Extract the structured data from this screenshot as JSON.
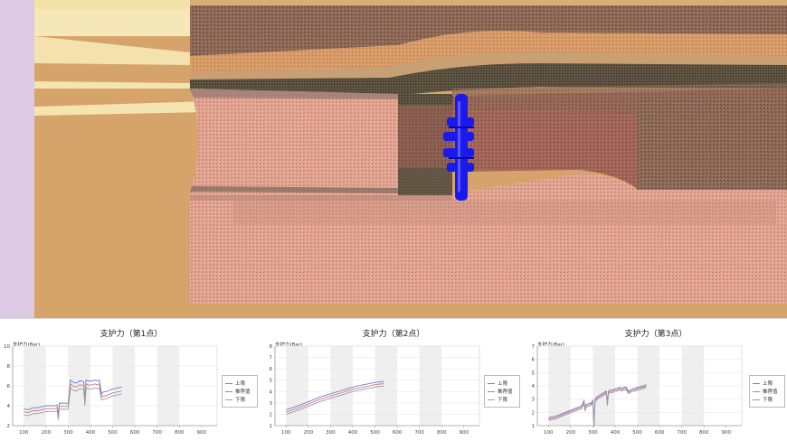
{
  "colors": {
    "cutter_head": "#1a1aee",
    "series_upper": "#6a7fd0",
    "series_recommended": "#d07a7a",
    "series_lower": "#9a9aa8"
  },
  "scene": {
    "name": "tbm-tunnel-3d-view",
    "icon": "cutter-head-icon"
  },
  "charts": [
    {
      "title": "支护力（第1点）",
      "unit_label": "支护力(Bar)",
      "legend": [
        "上限",
        "推荐值",
        "下限"
      ],
      "chart_data": {
        "type": "line",
        "xlim": [
          50,
          970
        ],
        "ylim": [
          2,
          10
        ],
        "x_ticks": [
          100,
          200,
          300,
          400,
          500,
          600,
          700,
          800,
          900
        ],
        "y_ticks": [
          2,
          4,
          6,
          8,
          10
        ],
        "shaded_bands": [
          [
            100,
            200
          ],
          [
            300,
            400
          ],
          [
            500,
            600
          ],
          [
            700,
            800
          ]
        ],
        "series": [
          {
            "name": "上限",
            "x": [
              100,
              120,
              140,
              160,
              180,
              200,
              220,
              240,
              250,
              255,
              260,
              270,
              280,
              290,
              300,
              310,
              320,
              330,
              340,
              350,
              360,
              370,
              375,
              380,
              390,
              400,
              410,
              420,
              430,
              440,
              450,
              460,
              470,
              480,
              490,
              500,
              510,
              520,
              530,
              540
            ],
            "y": [
              3.7,
              3.6,
              3.8,
              3.8,
              3.9,
              4.0,
              4.0,
              4.0,
              4.1,
              3.0,
              4.3,
              4.2,
              4.3,
              4.2,
              4.3,
              6.6,
              6.4,
              6.3,
              6.3,
              6.5,
              6.5,
              6.4,
              4.6,
              6.6,
              6.5,
              6.5,
              6.5,
              6.6,
              6.5,
              6.6,
              5.2,
              5.4,
              5.4,
              5.5,
              5.6,
              5.7,
              5.7,
              5.8,
              5.8,
              5.9
            ]
          },
          {
            "name": "推荐值",
            "x": [
              100,
              120,
              140,
              160,
              180,
              200,
              220,
              240,
              250,
              255,
              260,
              270,
              280,
              290,
              300,
              310,
              320,
              330,
              340,
              350,
              360,
              370,
              375,
              380,
              390,
              400,
              410,
              420,
              430,
              440,
              450,
              460,
              470,
              480,
              490,
              500,
              510,
              520,
              530,
              540
            ],
            "y": [
              3.4,
              3.3,
              3.5,
              3.5,
              3.6,
              3.7,
              3.7,
              3.7,
              3.8,
              2.8,
              4.0,
              3.9,
              4.0,
              3.9,
              4.0,
              6.2,
              6.0,
              5.9,
              5.9,
              6.1,
              6.1,
              6.0,
              4.3,
              6.2,
              6.1,
              6.1,
              6.1,
              6.2,
              6.1,
              6.2,
              4.9,
              5.0,
              5.0,
              5.1,
              5.2,
              5.3,
              5.3,
              5.4,
              5.4,
              5.5
            ]
          },
          {
            "name": "下限",
            "x": [
              100,
              120,
              140,
              160,
              180,
              200,
              220,
              240,
              250,
              255,
              260,
              270,
              280,
              290,
              300,
              310,
              320,
              330,
              340,
              350,
              360,
              370,
              375,
              380,
              390,
              400,
              410,
              420,
              430,
              440,
              450,
              460,
              470,
              480,
              490,
              500,
              510,
              520,
              530,
              540
            ],
            "y": [
              3.1,
              3.0,
              3.2,
              3.2,
              3.3,
              3.4,
              3.4,
              3.4,
              3.5,
              2.6,
              3.7,
              3.6,
              3.7,
              3.6,
              3.7,
              5.8,
              5.6,
              5.5,
              5.5,
              5.7,
              5.7,
              5.6,
              4.0,
              5.8,
              5.7,
              5.7,
              5.7,
              5.8,
              5.7,
              5.8,
              4.6,
              4.7,
              4.7,
              4.8,
              4.9,
              5.0,
              5.0,
              5.1,
              5.1,
              5.2
            ]
          }
        ]
      }
    },
    {
      "title": "支护力（第2点）",
      "unit_label": "支护力(Bar)",
      "legend": [
        "上限",
        "推荐值",
        "下限"
      ],
      "chart_data": {
        "type": "line",
        "xlim": [
          50,
          970
        ],
        "ylim": [
          1,
          8
        ],
        "x_ticks": [
          100,
          200,
          300,
          400,
          500,
          600,
          700,
          800,
          900
        ],
        "y_ticks": [
          1,
          2,
          3,
          4,
          5,
          6,
          7,
          8
        ],
        "shaded_bands": [
          [
            100,
            200
          ],
          [
            300,
            400
          ],
          [
            500,
            600
          ],
          [
            700,
            800
          ]
        ],
        "series": [
          {
            "name": "上限",
            "x": [
              100,
              130,
              160,
              200,
              250,
              300,
              350,
              400,
              450,
              500,
              540
            ],
            "y": [
              2.4,
              2.6,
              2.8,
              3.1,
              3.5,
              3.8,
              4.1,
              4.4,
              4.6,
              4.8,
              4.9
            ]
          },
          {
            "name": "推荐值",
            "x": [
              100,
              130,
              160,
              200,
              250,
              300,
              350,
              400,
              450,
              500,
              540
            ],
            "y": [
              2.2,
              2.4,
              2.6,
              2.9,
              3.3,
              3.6,
              3.9,
              4.2,
              4.4,
              4.6,
              4.7
            ]
          },
          {
            "name": "下限",
            "x": [
              100,
              130,
              160,
              200,
              250,
              300,
              350,
              400,
              450,
              500,
              540
            ],
            "y": [
              2.0,
              2.2,
              2.4,
              2.7,
              3.1,
              3.4,
              3.7,
              4.0,
              4.2,
              4.4,
              4.5
            ]
          }
        ]
      }
    },
    {
      "title": "支护力（第3点）",
      "unit_label": "支护力(Bar)",
      "legend": [
        "上限",
        "推荐值",
        "下限"
      ],
      "chart_data": {
        "type": "line",
        "xlim": [
          50,
          970
        ],
        "ylim": [
          1,
          7
        ],
        "x_ticks": [
          100,
          200,
          300,
          400,
          500,
          600,
          700,
          800,
          900
        ],
        "y_ticks": [
          1,
          2,
          3,
          4,
          5,
          6,
          7
        ],
        "shaded_bands": [
          [
            100,
            200
          ],
          [
            300,
            400
          ],
          [
            500,
            600
          ],
          [
            700,
            800
          ]
        ],
        "series": [
          {
            "name": "上限",
            "x": [
              100,
              130,
              160,
              190,
              220,
              250,
              260,
              265,
              270,
              290,
              300,
              305,
              310,
              320,
              330,
              340,
              350,
              360,
              365,
              370,
              380,
              390,
              400,
              410,
              420,
              430,
              440,
              450,
              460,
              470,
              480,
              490,
              500,
              510,
              520,
              530,
              540
            ],
            "y": [
              1.6,
              1.7,
              1.9,
              2.1,
              2.3,
              2.5,
              2.9,
              2.3,
              2.6,
              2.7,
              2.9,
              1.1,
              3.0,
              3.2,
              3.3,
              3.4,
              3.5,
              3.6,
              2.7,
              3.6,
              3.7,
              3.7,
              3.8,
              3.8,
              3.9,
              3.8,
              3.9,
              3.9,
              3.6,
              3.7,
              3.8,
              3.8,
              3.9,
              3.9,
              4.0,
              4.0,
              4.1
            ]
          },
          {
            "name": "推荐值",
            "x": [
              100,
              130,
              160,
              190,
              220,
              250,
              260,
              265,
              270,
              290,
              300,
              305,
              310,
              320,
              330,
              340,
              350,
              360,
              365,
              370,
              380,
              390,
              400,
              410,
              420,
              430,
              440,
              450,
              460,
              470,
              480,
              490,
              500,
              510,
              520,
              530,
              540
            ],
            "y": [
              1.5,
              1.6,
              1.8,
              2.0,
              2.2,
              2.4,
              2.8,
              2.2,
              2.5,
              2.6,
              2.8,
              1.0,
              2.9,
              3.1,
              3.2,
              3.3,
              3.4,
              3.5,
              2.6,
              3.5,
              3.6,
              3.6,
              3.7,
              3.7,
              3.8,
              3.7,
              3.8,
              3.8,
              3.5,
              3.6,
              3.7,
              3.7,
              3.8,
              3.8,
              3.9,
              3.9,
              4.0
            ]
          },
          {
            "name": "下限",
            "x": [
              100,
              130,
              160,
              190,
              220,
              250,
              260,
              265,
              270,
              290,
              300,
              305,
              310,
              320,
              330,
              340,
              350,
              360,
              365,
              370,
              380,
              390,
              400,
              410,
              420,
              430,
              440,
              450,
              460,
              470,
              480,
              490,
              500,
              510,
              520,
              530,
              540
            ],
            "y": [
              1.4,
              1.5,
              1.7,
              1.9,
              2.1,
              2.3,
              2.7,
              2.1,
              2.4,
              2.5,
              2.7,
              0.9,
              2.8,
              3.0,
              3.1,
              3.2,
              3.3,
              3.4,
              2.5,
              3.4,
              3.5,
              3.5,
              3.6,
              3.6,
              3.7,
              3.6,
              3.7,
              3.7,
              3.4,
              3.5,
              3.6,
              3.6,
              3.7,
              3.7,
              3.8,
              3.8,
              3.9
            ]
          }
        ]
      }
    }
  ]
}
